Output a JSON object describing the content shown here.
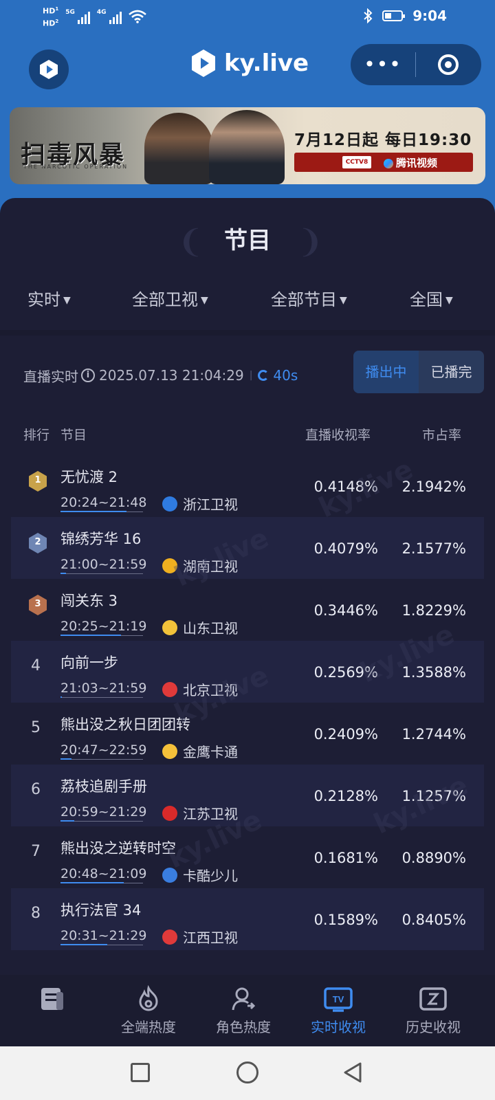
{
  "status_bar": {
    "hd1": "HD",
    "hd1_sub": "1",
    "hd2": "HD",
    "hd2_sub": "2",
    "net1": "5G",
    "net2": "4G",
    "time": "9:04"
  },
  "header": {
    "brand": "ky.live",
    "more_label": "•••"
  },
  "banner": {
    "show_title": "扫毒风暴",
    "show_subtitle": "THE NARCOTIC OPERATION",
    "airdate": "7月12日起 每日19:30播出",
    "channel": "CCTV8",
    "platform": "腾讯视频"
  },
  "section": {
    "title": "节目"
  },
  "filters": [
    {
      "label": "实时"
    },
    {
      "label": "全部卫视"
    },
    {
      "label": "全部节目"
    },
    {
      "label": "全国"
    }
  ],
  "live": {
    "label": "直播实时",
    "datetime": "2025.07.13 21:04:29",
    "refresh": "40s"
  },
  "toggle": {
    "on_air": "播出中",
    "finished": "已播完"
  },
  "table": {
    "headers": {
      "rank": "排行",
      "program": "节目",
      "rating": "直播收视率",
      "share": "市占率"
    },
    "rows": [
      {
        "rank": "1",
        "name": "无忧渡 2",
        "time": "20:24~21:48",
        "channel": "浙江卫视",
        "rating": "0.4148%",
        "share": "2.1942%",
        "progress": 0.8,
        "channel_color": "#2f7be0"
      },
      {
        "rank": "2",
        "name": "锦绣芳华 16",
        "time": "21:00~21:59",
        "channel": "湖南卫视",
        "rating": "0.4079%",
        "share": "2.1577%",
        "progress": 0.07,
        "channel_color": "#f0b020"
      },
      {
        "rank": "3",
        "name": "闯关东 3",
        "time": "20:25~21:19",
        "channel": "山东卫视",
        "rating": "0.3446%",
        "share": "1.8229%",
        "progress": 0.73,
        "channel_color": "#f2c23a"
      },
      {
        "rank": "4",
        "name": "向前一步",
        "time": "21:03~21:59",
        "channel": "北京卫视",
        "rating": "0.2569%",
        "share": "1.3588%",
        "progress": 0.02,
        "channel_color": "#e03a3a"
      },
      {
        "rank": "5",
        "name": "熊出没之秋日团团转",
        "time": "20:47~22:59",
        "channel": "金鹰卡通",
        "rating": "0.2409%",
        "share": "1.2744%",
        "progress": 0.13,
        "channel_color": "#f5c13a"
      },
      {
        "rank": "6",
        "name": "荔枝追剧手册",
        "time": "20:59~21:29",
        "channel": "江苏卫视",
        "rating": "0.2128%",
        "share": "1.1257%",
        "progress": 0.17,
        "channel_color": "#d92a2a"
      },
      {
        "rank": "7",
        "name": "熊出没之逆转时空",
        "time": "20:48~21:09",
        "channel": "卡酷少儿",
        "rating": "0.1681%",
        "share": "0.8890%",
        "progress": 0.77,
        "channel_color": "#3a7ee0"
      },
      {
        "rank": "8",
        "name": "执行法官 34",
        "time": "20:31~21:29",
        "channel": "江西卫视",
        "rating": "0.1589%",
        "share": "0.8405%",
        "progress": 0.57,
        "channel_color": "#e03a3a"
      }
    ]
  },
  "bottom_nav": [
    {
      "label": "",
      "icon": "board-icon",
      "active": false
    },
    {
      "label": "全端热度",
      "icon": "flame-icon",
      "active": false
    },
    {
      "label": "角色热度",
      "icon": "person-icon",
      "active": false
    },
    {
      "label": "实时收视",
      "icon": "tv-icon",
      "active": true
    },
    {
      "label": "历史收视",
      "icon": "history-icon",
      "active": false
    }
  ],
  "colors": {
    "brand_blue": "#2a6fc0",
    "panel_bg": "#1d1e35",
    "accent": "#3f8cf0",
    "gold": "#c8a24a",
    "silver": "#6f86b4",
    "bronze": "#b9714e"
  },
  "watermark": "ky.live"
}
